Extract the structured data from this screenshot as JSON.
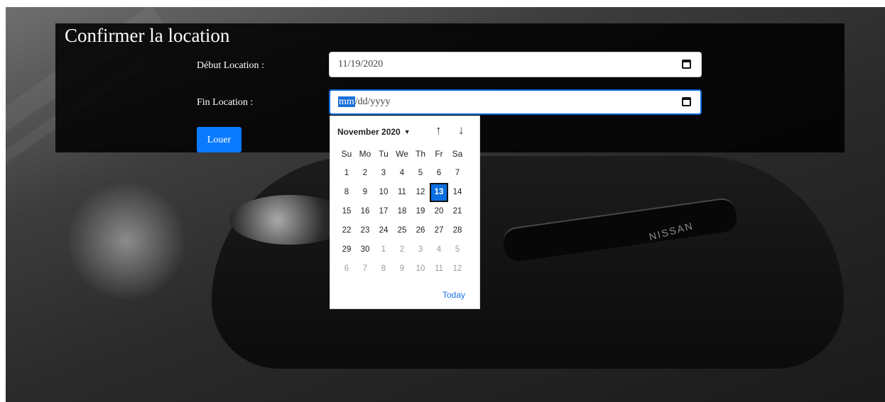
{
  "form": {
    "title": "Confirmer la location",
    "start_label": "Début Location :",
    "start_value": "11/19/2020",
    "end_label": "Fin Location :",
    "end_segments": {
      "month": "mm",
      "rest": "/dd/yyyy"
    },
    "submit_label": "Louer"
  },
  "background": {
    "brand_text": "NISSAN"
  },
  "calendar": {
    "month_label": "November 2020",
    "weekdays": [
      "Su",
      "Mo",
      "Tu",
      "We",
      "Th",
      "Fr",
      "Sa"
    ],
    "weeks": [
      [
        {
          "d": "1"
        },
        {
          "d": "2"
        },
        {
          "d": "3"
        },
        {
          "d": "4"
        },
        {
          "d": "5"
        },
        {
          "d": "6"
        },
        {
          "d": "7"
        }
      ],
      [
        {
          "d": "8"
        },
        {
          "d": "9"
        },
        {
          "d": "10"
        },
        {
          "d": "11"
        },
        {
          "d": "12"
        },
        {
          "d": "13",
          "sel": true
        },
        {
          "d": "14"
        }
      ],
      [
        {
          "d": "15"
        },
        {
          "d": "16"
        },
        {
          "d": "17"
        },
        {
          "d": "18"
        },
        {
          "d": "19"
        },
        {
          "d": "20"
        },
        {
          "d": "21"
        }
      ],
      [
        {
          "d": "22"
        },
        {
          "d": "23"
        },
        {
          "d": "24"
        },
        {
          "d": "25"
        },
        {
          "d": "26"
        },
        {
          "d": "27"
        },
        {
          "d": "28"
        }
      ],
      [
        {
          "d": "29"
        },
        {
          "d": "30"
        },
        {
          "d": "1",
          "out": true
        },
        {
          "d": "2",
          "out": true
        },
        {
          "d": "3",
          "out": true
        },
        {
          "d": "4",
          "out": true
        },
        {
          "d": "5",
          "out": true
        }
      ],
      [
        {
          "d": "6",
          "out": true
        },
        {
          "d": "7",
          "out": true
        },
        {
          "d": "8",
          "out": true
        },
        {
          "d": "9",
          "out": true
        },
        {
          "d": "10",
          "out": true
        },
        {
          "d": "11",
          "out": true
        },
        {
          "d": "12",
          "out": true
        }
      ]
    ],
    "today_label": "Today"
  },
  "colors": {
    "accent": "#0a7aff",
    "selected_day": "#0a6fe0",
    "today_link": "#1a73e8"
  }
}
